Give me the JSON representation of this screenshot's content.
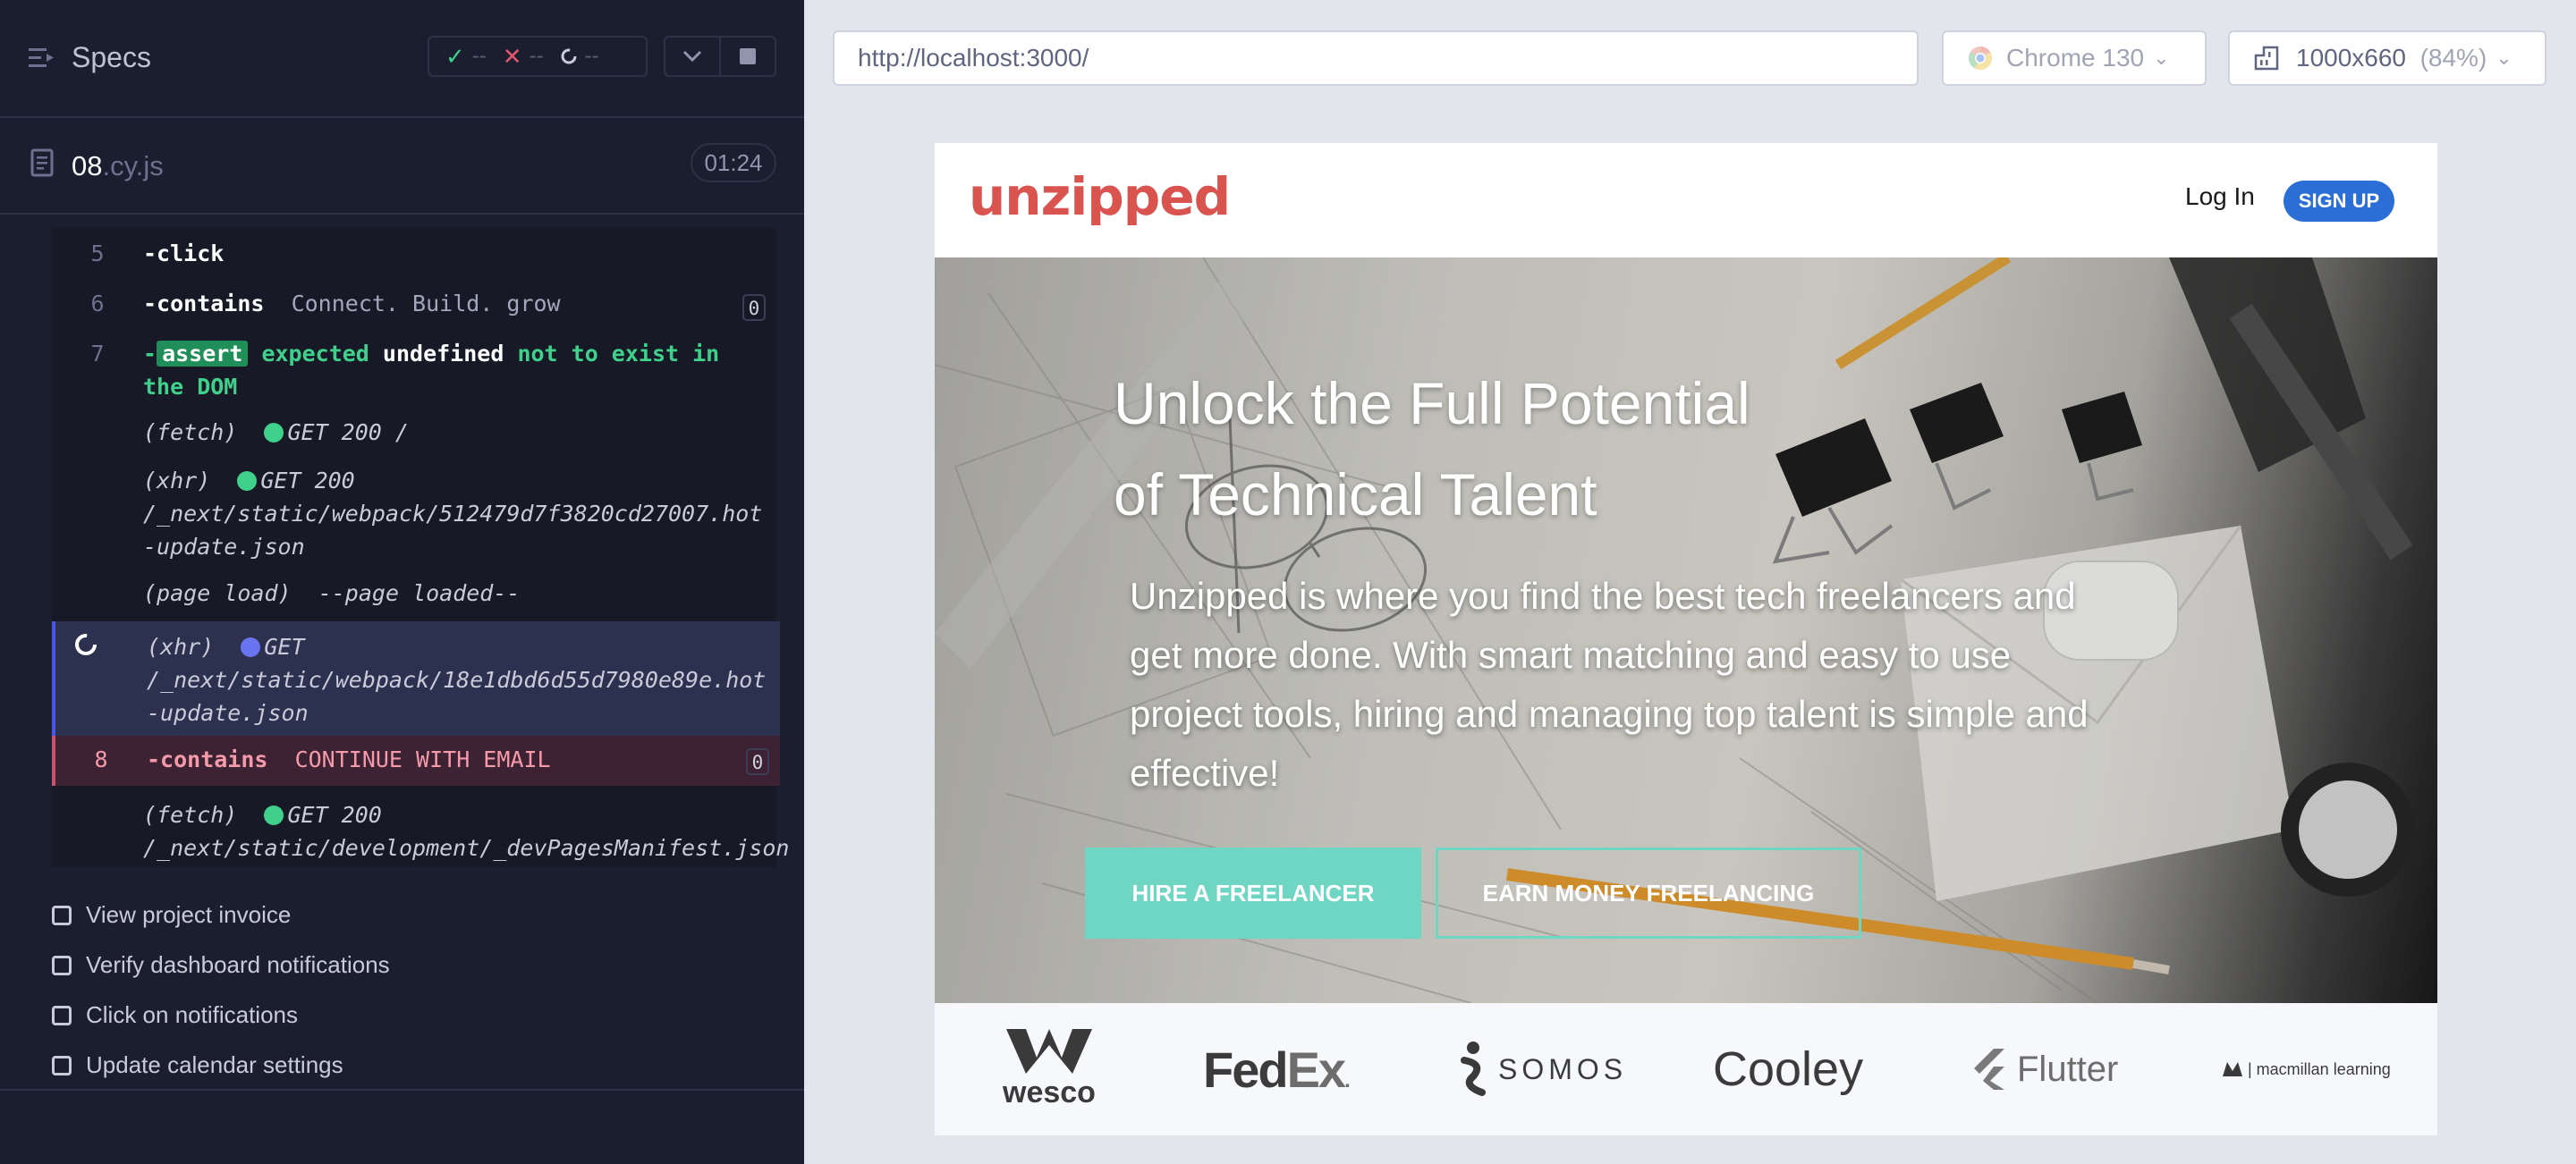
{
  "reporter": {
    "title": "Specs",
    "stats": {
      "passed": "--",
      "failed": "--",
      "pending": "--"
    },
    "file": {
      "name": "08",
      "ext": ".cy.js",
      "duration": "01:24"
    },
    "commands": {
      "c5": {
        "num": "5",
        "name": "-click"
      },
      "c6": {
        "num": "6",
        "name": "-contains",
        "arg": "Connect. Build. grow",
        "count": "0"
      },
      "c7": {
        "num": "7",
        "dash": "-",
        "badge": "assert",
        "w1": "expected",
        "w2": "undefined",
        "w3": "not to exist in",
        "w4": "the DOM"
      },
      "log1": {
        "kind": "(fetch)",
        "text": "GET 200 /"
      },
      "log2": {
        "kind": "(xhr)",
        "text": "GET 200",
        "path": "/_next/static/webpack/512479d7f3820cd27007.hot-update.json"
      },
      "log3": {
        "kind": "(page load)",
        "text": "--page loaded--"
      },
      "log4": {
        "kind": "(xhr)",
        "text": "GET",
        "path": "/_next/static/webpack/18e1dbd6d55d7980e89e.hot-update.json"
      },
      "c8": {
        "num": "8",
        "name": "-contains",
        "arg": "CONTINUE WITH EMAIL",
        "count": "0"
      },
      "log5": {
        "kind": "(fetch)",
        "text": "GET 200",
        "path": "/_next/static/development/_devPagesManifest.json"
      }
    },
    "tests": [
      "View project invoice",
      "Verify dashboard notifications",
      "Click on notifications",
      "Update calendar settings"
    ]
  },
  "aut": {
    "url": "http://localhost:3000/",
    "browser": "Chrome 130",
    "viewport": "1000x660",
    "zoom": "(84%)"
  },
  "site": {
    "logo": "unzipped",
    "login": "Log In",
    "signup": "SIGN UP",
    "hero_title_1": "Unlock the Full Potential",
    "hero_title_2": "of Technical Talent",
    "hero_sub": "Unzipped is where you find the best tech freelancers and get more done. With smart matching and easy to use project tools, hiring and managing top talent is simple and effective!",
    "hire_btn": "HIRE A FREELANCER",
    "earn_btn": "EARN MONEY FREELANCING",
    "logos": {
      "wesco": "wesco",
      "fedex_fed": "Fed",
      "fedex_ex": "Ex",
      "somos": "SOMOS",
      "cooley": "Cooley",
      "flutter": "Flutter",
      "macmillan": "| macmillan learning"
    }
  },
  "colors": {
    "reporter_bg": "#1b1e2e",
    "pass": "#3fd18c",
    "fail": "#e2586e",
    "pending_dot": "#6a74f0",
    "brand_red": "#d9534f",
    "signup_blue": "#2b6fd6",
    "teal": "#6fd6c4"
  }
}
